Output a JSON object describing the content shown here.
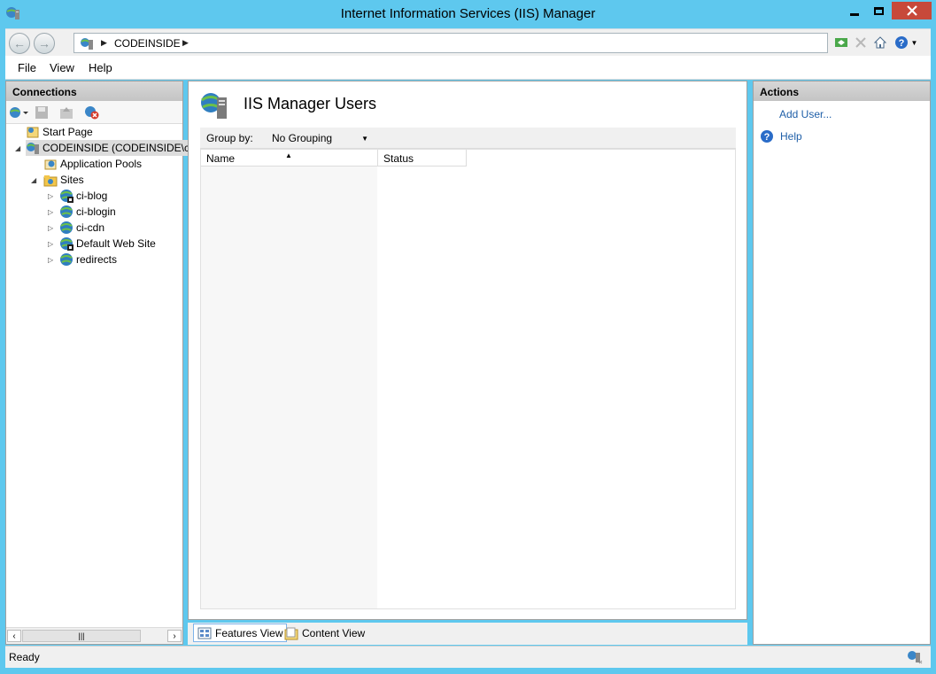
{
  "window": {
    "title": "Internet Information Services (IIS) Manager",
    "controls": {
      "minimize": "minimize",
      "maximize": "maximize",
      "close": "close"
    }
  },
  "nav": {
    "breadcrumb": "CODEINSIDE",
    "tools": [
      "refresh-icon",
      "stop-icon",
      "home-icon",
      "help-icon"
    ]
  },
  "menu": {
    "file": "File",
    "view": "View",
    "help": "Help"
  },
  "connections": {
    "header": "Connections",
    "tree": {
      "start_page": "Start Page",
      "server": "CODEINSIDE (CODEINSIDE\\co",
      "app_pools": "Application Pools",
      "sites": "Sites",
      "site_items": [
        "ci-blog",
        "ci-blogin",
        "ci-cdn",
        "Default Web Site",
        "redirects"
      ]
    }
  },
  "main": {
    "title": "IIS Manager Users",
    "group_by_label": "Group by:",
    "group_by_value": "No Grouping",
    "columns": {
      "name": "Name",
      "status": "Status"
    }
  },
  "views": {
    "features": "Features View",
    "content": "Content View"
  },
  "actions": {
    "header": "Actions",
    "add_user": "Add User...",
    "help": "Help"
  },
  "status": {
    "text": "Ready"
  },
  "colors": {
    "titlebar": "#5ec8ee",
    "close_button": "#c7493a",
    "link": "#1f5fa8"
  }
}
